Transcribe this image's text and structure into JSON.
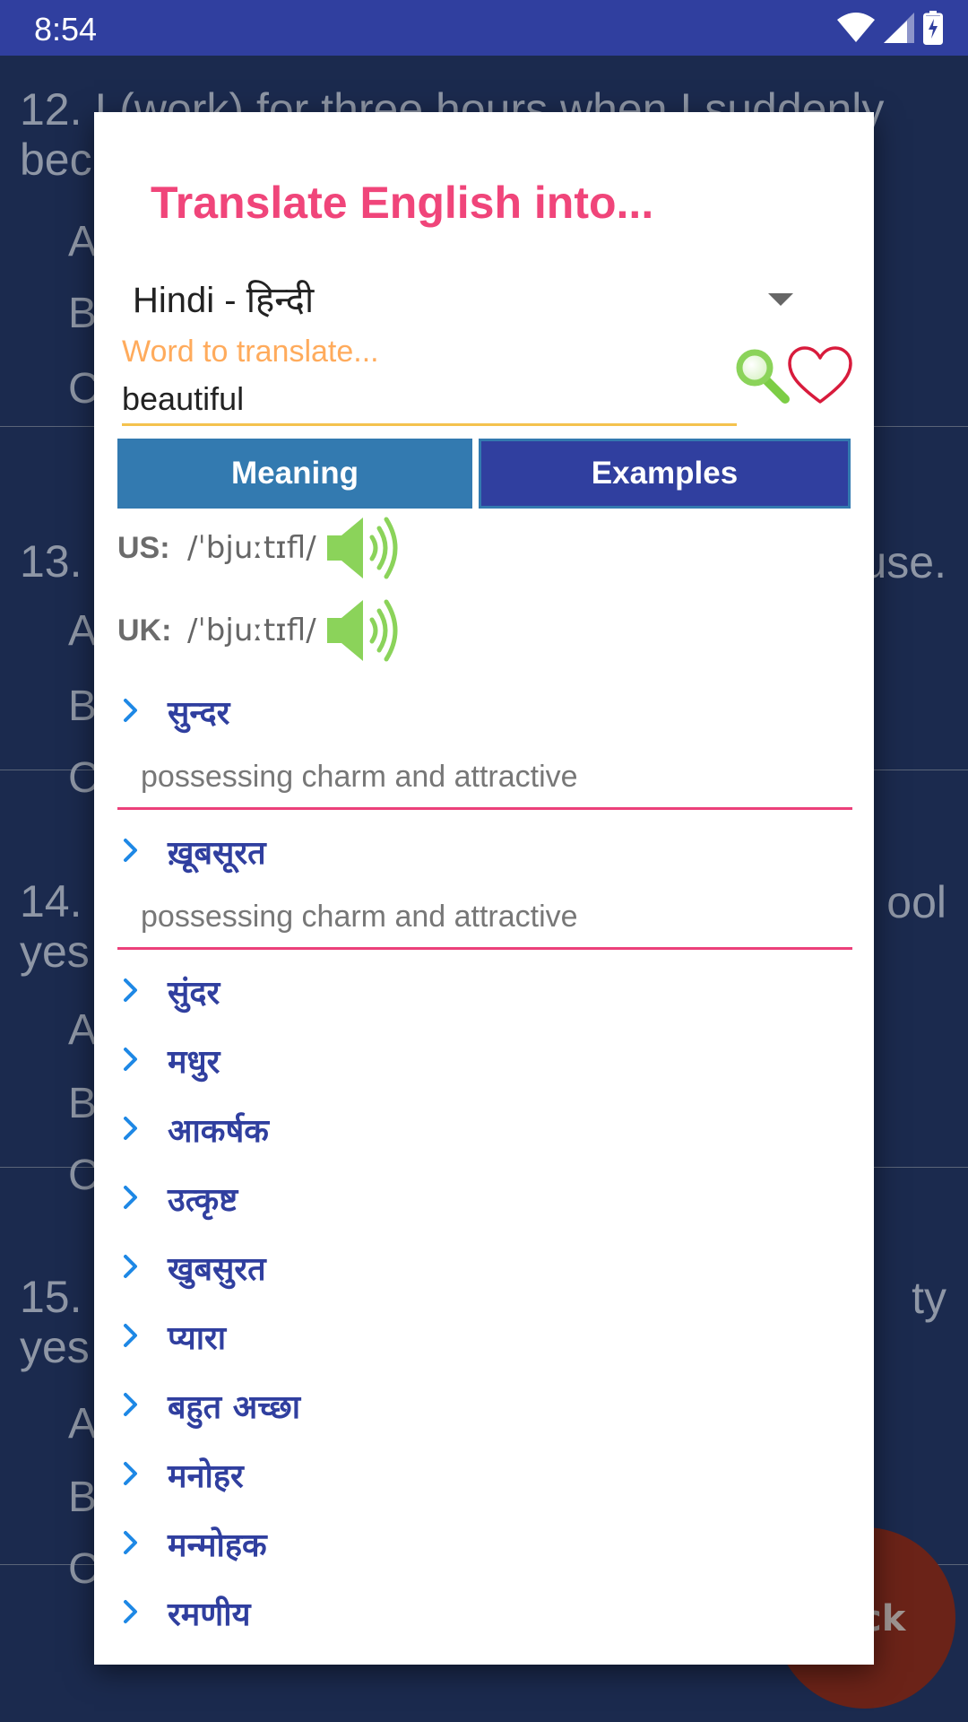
{
  "status_bar": {
    "time": "8:54",
    "icons": [
      "wifi-icon",
      "signal-icon",
      "battery-charging-icon"
    ]
  },
  "background": {
    "questions": [
      {
        "line1": "12. I (work) for three hours when I suddenly",
        "line2": "bec",
        "tail": "",
        "options": [
          "A",
          "B",
          "C"
        ]
      },
      {
        "line1": "13.",
        "line2": "",
        "tail": "use.",
        "options": [
          "A",
          "B",
          "C"
        ]
      },
      {
        "line1": "14.",
        "line2": "yes",
        "tail": "ool",
        "options": [
          "A",
          "B",
          "C"
        ]
      },
      {
        "line1": "15.",
        "line2": "yes",
        "tail": "ty",
        "options": [
          "A",
          "B",
          "C"
        ]
      }
    ],
    "fab_label": "ck"
  },
  "dialog": {
    "title": "Translate English into...",
    "language": "Hindi - हिन्दी",
    "input_label": "Word to translate...",
    "input_value": "beautiful",
    "tabs": {
      "meaning": "Meaning",
      "examples": "Examples"
    },
    "pronunciations": [
      {
        "label": "US:",
        "ipa": "/ˈbjuːtɪfl/"
      },
      {
        "label": "UK:",
        "ipa": "/ˈbjuːtɪfl/"
      }
    ],
    "meanings": [
      {
        "word": "सुन्दर",
        "definition": "possessing charm and attractive"
      },
      {
        "word": "ख़ूबसूरत",
        "definition": "possessing charm and attractive"
      },
      {
        "word": "सुंदर"
      },
      {
        "word": "मधुर"
      },
      {
        "word": "आकर्षक"
      },
      {
        "word": "उत्कृष्ट"
      },
      {
        "word": "खुबसुरत"
      },
      {
        "word": "प्यारा"
      },
      {
        "word": "बहुत अच्छा"
      },
      {
        "word": "मनोहर"
      },
      {
        "word": "मन्मोहक"
      },
      {
        "word": "रमणीय"
      }
    ]
  },
  "colors": {
    "status_bar": "#303f9f",
    "title": "#f0457a",
    "input_label": "#ffab5c",
    "input_underline": "#f4c24e",
    "tab_meaning": "#337ab0",
    "tab_examples": "#303f9f",
    "meaning_word": "#303f9f",
    "chevron": "#1e88e5",
    "divider": "#ec407a",
    "speaker": "#8bd35a"
  }
}
